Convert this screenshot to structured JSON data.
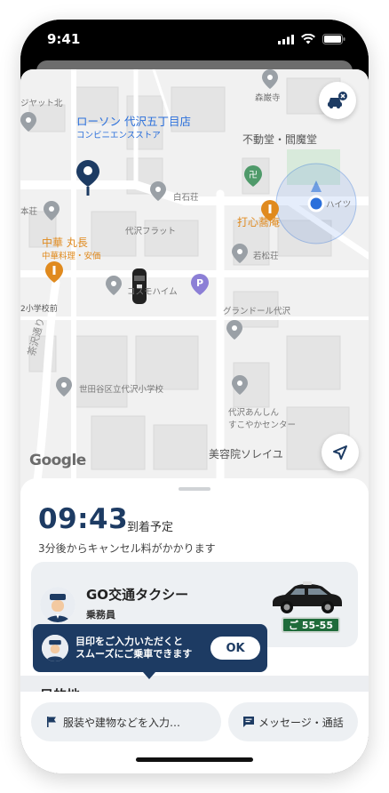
{
  "status_bar": {
    "time": "9:41"
  },
  "map": {
    "pois": {
      "lawson_name": "ローソン 代沢五丁目店",
      "lawson_sub": "コンビニエンスストア",
      "chinese_name": "中華 丸長",
      "chinese_sub": "中華料理・安価",
      "fudodo": "不動堂・閻魔堂",
      "uchikome": "打心蕎庵",
      "morizaki": "森巌寺",
      "shiraishi": "白石荘",
      "daizawa_flat": "代沢フラット",
      "wakamatsu": "若松荘",
      "cosmo": "コスモハイム",
      "grand": "グランドール代沢",
      "school": "世田谷区立代沢小学校",
      "annaishin": "代沢あんしん",
      "sukoyaka": "すこやかセンター",
      "biyoin": "美容院ソレイユ",
      "hon": "本荘",
      "jikattakita": "ジヤット北",
      "chazawa": "茶沢通り",
      "school_front": "2小学校前",
      "haitsu": "ハイツ",
      "google": "Google"
    }
  },
  "trip": {
    "eta_time": "09:43",
    "eta_label": "到着予定",
    "cancel_note": "3分後からキャンセル料がかかります"
  },
  "driver": {
    "company": "GO交通タクシー",
    "role": "乗務員",
    "plate": "ご 55-55"
  },
  "tooltip": {
    "line1": "目印をご入力いただくと",
    "line2": "スムーズにご乗車できます",
    "ok_label": "OK"
  },
  "destination": {
    "title": "目的地"
  },
  "actions": {
    "landmark_label": "服装や建物などを入力…",
    "message_label": "メッセージ・通話"
  },
  "colors": {
    "navy": "#1d3b63",
    "plate_green": "#1f6b3a",
    "map_blue": "#2a6fdb",
    "map_orange": "#e08a1e"
  }
}
